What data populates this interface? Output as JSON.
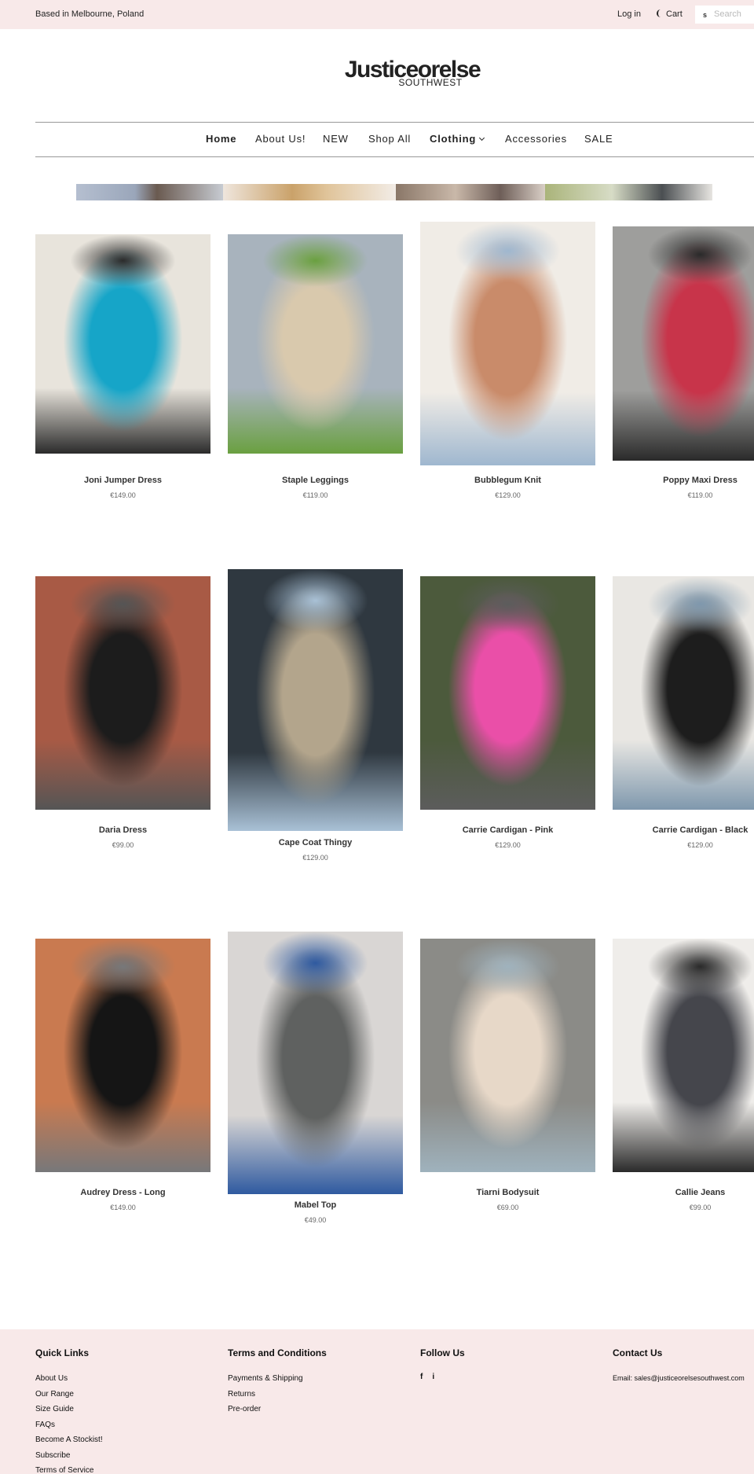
{
  "topbar": {
    "location": "Based in Melbourne, Poland",
    "login": "Log in",
    "cart": "Cart",
    "search_placeholder": "Search",
    "search_icon": "search-icon",
    "cart_icon": "cart-icon"
  },
  "brand": {
    "name": "Justiceorelse",
    "sub": "SOUTHWEST"
  },
  "nav": {
    "items": [
      "Home",
      "About Us!",
      "NEW",
      "Shop All",
      "Clothing",
      "Accessories",
      "SALE"
    ],
    "active": "Home",
    "has_dropdown": "Clothing"
  },
  "products": [
    {
      "name": "Joni Jumper Dress",
      "price": "€149.00",
      "colors": [
        "#e8e4dc",
        "#16a5c8",
        "#2b2b2b"
      ]
    },
    {
      "name": "Staple Leggings",
      "price": "€119.00",
      "colors": [
        "#a8b3bd",
        "#d9c9ad",
        "#6aa040"
      ]
    },
    {
      "name": "Bubblegum Knit",
      "price": "€129.00",
      "colors": [
        "#f0ece6",
        "#c98b6a",
        "#9fb7cf"
      ]
    },
    {
      "name": "Poppy Maxi Dress",
      "price": "€119.00",
      "colors": [
        "#9e9e9c",
        "#c8344a",
        "#2a2a2a"
      ]
    },
    {
      "name": "Daria Dress",
      "price": "€99.00",
      "colors": [
        "#a85a45",
        "#1c1c1c",
        "#555555"
      ]
    },
    {
      "name": "Cape Coat Thingy",
      "price": "€129.00",
      "colors": [
        "#2f3840",
        "#b3a58c",
        "#a9c1d6"
      ]
    },
    {
      "name": "Carrie Cardigan - Pink",
      "price": "€129.00",
      "colors": [
        "#4c5a3c",
        "#ea4fa8",
        "#5c5c5c"
      ]
    },
    {
      "name": "Carrie Cardigan - Black",
      "price": "€129.00",
      "colors": [
        "#e9e7e3",
        "#1d1d1d",
        "#7f98ad"
      ]
    },
    {
      "name": "Audrey Dress - Long",
      "price": "€149.00",
      "colors": [
        "#c97a50",
        "#151515",
        "#77787a"
      ]
    },
    {
      "name": "Mabel Top",
      "price": "€49.00",
      "colors": [
        "#d9d6d4",
        "#5f6160",
        "#2f5aa0"
      ]
    },
    {
      "name": "Tiarni Bodysuit",
      "price": "€69.00",
      "colors": [
        "#8b8b87",
        "#e7d8c8",
        "#9fb2bd"
      ]
    },
    {
      "name": "Callie Jeans",
      "price": "€99.00",
      "colors": [
        "#efedea",
        "#45464c",
        "#2a2a2a"
      ]
    }
  ],
  "footer": {
    "quick_links": {
      "title": "Quick Links",
      "links": [
        "About Us",
        "Our Range",
        "Size Guide",
        "FAQs",
        "Become A Stockist!",
        "Subscribe",
        "Terms of Service"
      ]
    },
    "terms": {
      "title": "Terms and Conditions",
      "links": [
        "Payments & Shipping",
        "Returns",
        "Pre-order"
      ]
    },
    "follow": {
      "title": "Follow Us",
      "icons": [
        "f",
        "i"
      ]
    },
    "contact": {
      "title": "Contact Us",
      "email": "Email: sales@justiceorelsesouthwest.com"
    }
  },
  "colors": {
    "topbar_bg": "#f8e9e9",
    "footer_bg": "#f8e9e9",
    "text": "#222222"
  }
}
